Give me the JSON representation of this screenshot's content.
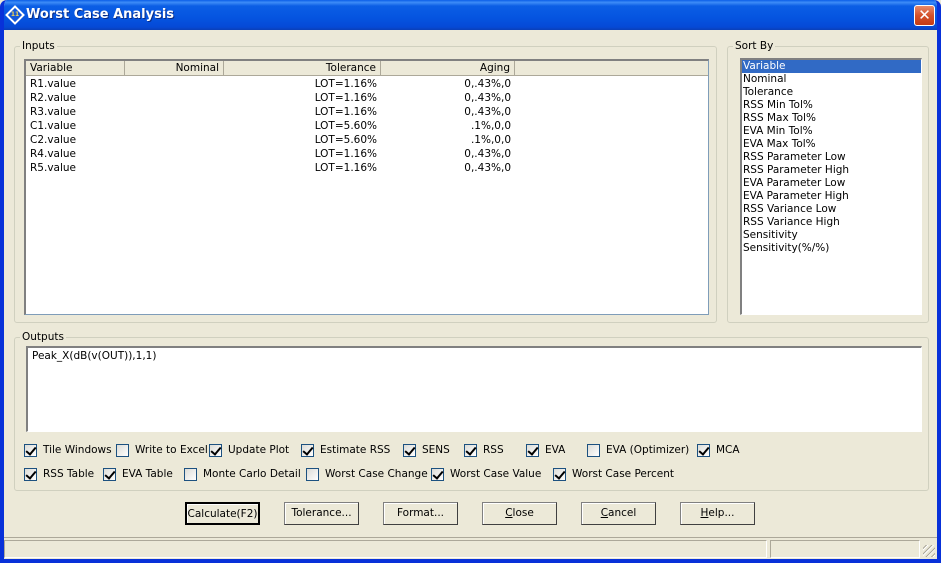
{
  "window": {
    "title": "Worst Case Analysis",
    "icon": "app-diamond-icon",
    "icon_glyph": "11",
    "close_glyph": "✕"
  },
  "inputs": {
    "legend": "Inputs",
    "columns": [
      "Variable",
      "Nominal",
      "Tolerance",
      "Aging"
    ],
    "rows": [
      {
        "variable": "R1.value",
        "nominal": "",
        "tolerance": "LOT=1.16%",
        "aging": "0,.43%,0"
      },
      {
        "variable": "R2.value",
        "nominal": "",
        "tolerance": "LOT=1.16%",
        "aging": "0,.43%,0"
      },
      {
        "variable": "R3.value",
        "nominal": "",
        "tolerance": "LOT=1.16%",
        "aging": "0,.43%,0"
      },
      {
        "variable": "C1.value",
        "nominal": "",
        "tolerance": "LOT=5.60%",
        "aging": ".1%,0,0"
      },
      {
        "variable": "C2.value",
        "nominal": "",
        "tolerance": "LOT=5.60%",
        "aging": ".1%,0,0"
      },
      {
        "variable": "R4.value",
        "nominal": "",
        "tolerance": "LOT=1.16%",
        "aging": "0,.43%,0"
      },
      {
        "variable": "R5.value",
        "nominal": "",
        "tolerance": "LOT=1.16%",
        "aging": "0,.43%,0"
      }
    ]
  },
  "sort_by": {
    "legend": "Sort By",
    "selected": "Variable",
    "items": [
      "Variable",
      "Nominal",
      "Tolerance",
      "RSS Min Tol%",
      "RSS Max Tol%",
      "EVA Min Tol%",
      "EVA Max Tol%",
      "RSS Parameter Low",
      "RSS Parameter High",
      "EVA Parameter Low",
      "EVA Parameter High",
      "RSS Variance Low",
      "RSS Variance High",
      "Sensitivity",
      "Sensitivity(%/%)"
    ]
  },
  "outputs": {
    "legend": "Outputs",
    "value": "Peak_X(dB(v(OUT)),1,1)"
  },
  "options_row1": [
    {
      "label": "Tile Windows",
      "checked": true
    },
    {
      "label": "Write to Excel",
      "checked": false
    },
    {
      "label": "Update Plot",
      "checked": true
    },
    {
      "label": "Estimate RSS",
      "checked": true
    },
    {
      "label": "SENS",
      "checked": true
    },
    {
      "label": "RSS",
      "checked": true
    },
    {
      "label": "EVA",
      "checked": true
    },
    {
      "label": "EVA (Optimizer)",
      "checked": false
    },
    {
      "label": "MCA",
      "checked": true
    }
  ],
  "options_row2": [
    {
      "label": "RSS Table",
      "checked": true
    },
    {
      "label": "EVA Table",
      "checked": true
    },
    {
      "label": "Monte Carlo Detail",
      "checked": false
    },
    {
      "label": "Worst Case Change",
      "checked": false
    },
    {
      "label": "Worst Case Value",
      "checked": true
    },
    {
      "label": "Worst Case Percent",
      "checked": true
    }
  ],
  "buttons": {
    "calculate": "Calculate(F2)",
    "tolerance": "Tolerance...",
    "format": "Format...",
    "close_accel": "C",
    "close_rest": "lose",
    "cancel_accel": "C",
    "cancel_rest": "ancel",
    "help_accel": "H",
    "help_rest": "elp..."
  },
  "statusbar": {
    "pane1": "",
    "pane2": ""
  }
}
